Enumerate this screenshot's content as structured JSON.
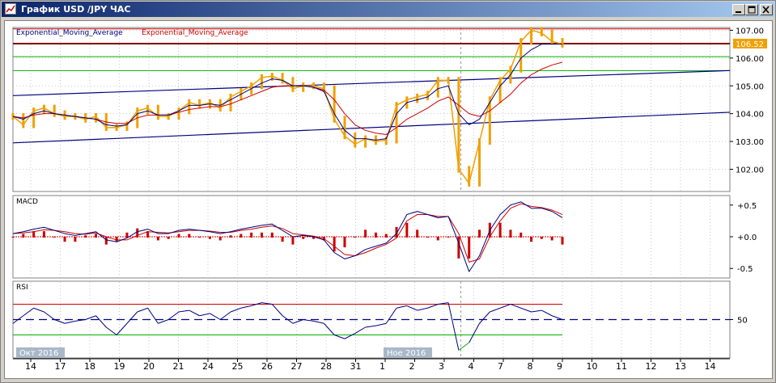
{
  "window": {
    "title": "График USD /JPY ЧАС",
    "buttons": {
      "minimize": "minimize-icon",
      "maximize": "maximize-icon",
      "close": "close-icon"
    }
  },
  "colors": {
    "price": "#f0a000",
    "ema_fast": "#000080",
    "ema_slow": "#cc0000",
    "resistance_line": "#cc0000",
    "support_line": "#00b000",
    "trend_line": "#000080",
    "macd_line": "#000080",
    "signal_line": "#cc0000",
    "histogram": "#cc0000",
    "rsi": "#000080",
    "rsi_overbought": "#e000e0",
    "rsi_oversold": "#00b000",
    "price_label_bg": "#f0a000",
    "date_marker_bg": "#a8b8c8"
  },
  "chart_data": [
    {
      "type": "line",
      "panel": "price",
      "legend": [
        "Exponential_Moving_Average",
        "Exponential_Moving_Average"
      ],
      "last_price_label": "106.52",
      "y_ticks": [
        "107.00",
        "106.00",
        "105.00",
        "104.00",
        "103.00",
        "102.00"
      ],
      "ylim": [
        101.2,
        107.1
      ],
      "horizontal_levels": [
        {
          "value": 107.05,
          "color": "red"
        },
        {
          "value": 106.52,
          "color": "darkred"
        },
        {
          "value": 106.05,
          "color": "green"
        },
        {
          "value": 105.55,
          "color": "green"
        }
      ],
      "trend_lines": [
        {
          "from": [
            0,
            104.65
          ],
          "to": [
            54,
            105.55
          ]
        },
        {
          "from": [
            0,
            102.95
          ],
          "to": [
            54,
            104.05
          ]
        }
      ],
      "series": [
        {
          "name": "price",
          "x": [
            0,
            1,
            2,
            3,
            4,
            5,
            6,
            7,
            8,
            9,
            10,
            11,
            12,
            13,
            14,
            15,
            16,
            17,
            18,
            19,
            20,
            21,
            22,
            23,
            24,
            25,
            26,
            27,
            28,
            29,
            30,
            31,
            32,
            33,
            34,
            35,
            36,
            37,
            38,
            39,
            40,
            41,
            42,
            43,
            44,
            45,
            46,
            47,
            48,
            49,
            50,
            51,
            52,
            53
          ],
          "values": [
            103.9,
            103.6,
            104.1,
            104.2,
            104.0,
            103.9,
            103.9,
            103.8,
            103.9,
            103.5,
            103.5,
            103.6,
            104.1,
            104.2,
            103.9,
            103.9,
            104.1,
            104.4,
            104.3,
            104.4,
            104.2,
            104.6,
            104.8,
            105.0,
            105.3,
            105.35,
            105.2,
            104.9,
            105.0,
            105.0,
            104.9,
            103.8,
            103.2,
            102.9,
            103.1,
            103.0,
            103.05,
            104.3,
            104.5,
            104.6,
            104.7,
            105.2,
            105.2,
            102.0,
            101.5,
            103.0,
            104.5,
            105.2,
            105.6,
            106.6,
            107.0,
            106.9,
            106.6,
            106.5
          ]
        },
        {
          "name": "ema_fast",
          "x": [
            0,
            1,
            2,
            3,
            4,
            5,
            6,
            7,
            8,
            9,
            10,
            11,
            12,
            13,
            14,
            15,
            16,
            17,
            18,
            19,
            20,
            21,
            22,
            23,
            24,
            25,
            26,
            27,
            28,
            29,
            30,
            31,
            32,
            33,
            34,
            35,
            36,
            37,
            38,
            39,
            40,
            41,
            42,
            43,
            44,
            45,
            46,
            47,
            48,
            49,
            50,
            51,
            52,
            53
          ],
          "values": [
            103.9,
            103.8,
            104.0,
            104.1,
            104.0,
            103.95,
            103.9,
            103.85,
            103.8,
            103.6,
            103.55,
            103.6,
            104.0,
            104.1,
            103.95,
            103.95,
            104.1,
            104.3,
            104.3,
            104.35,
            104.3,
            104.5,
            104.7,
            104.9,
            105.1,
            105.25,
            105.2,
            105.0,
            105.0,
            104.95,
            104.8,
            104.0,
            103.4,
            103.1,
            103.1,
            103.05,
            103.1,
            104.0,
            104.4,
            104.5,
            104.6,
            104.9,
            105.0,
            104.0,
            103.6,
            103.8,
            104.4,
            105.0,
            105.4,
            106.0,
            106.3,
            106.5,
            106.5,
            106.5
          ]
        },
        {
          "name": "ema_slow",
          "x": [
            0,
            1,
            2,
            3,
            4,
            5,
            6,
            7,
            8,
            9,
            10,
            11,
            12,
            13,
            14,
            15,
            16,
            17,
            18,
            19,
            20,
            21,
            22,
            23,
            24,
            25,
            26,
            27,
            28,
            29,
            30,
            31,
            32,
            33,
            34,
            35,
            36,
            37,
            38,
            39,
            40,
            41,
            42,
            43,
            44,
            45,
            46,
            47,
            48,
            49,
            50,
            51,
            52,
            53
          ],
          "values": [
            103.9,
            103.85,
            103.95,
            104.0,
            104.0,
            103.95,
            103.9,
            103.85,
            103.8,
            103.7,
            103.65,
            103.65,
            103.85,
            103.95,
            103.95,
            103.95,
            104.05,
            104.15,
            104.2,
            104.25,
            104.25,
            104.35,
            104.5,
            104.65,
            104.8,
            104.95,
            105.0,
            105.0,
            105.0,
            104.95,
            104.85,
            104.5,
            104.0,
            103.6,
            103.4,
            103.3,
            103.25,
            103.5,
            103.8,
            104.0,
            104.2,
            104.45,
            104.6,
            104.3,
            104.0,
            103.9,
            104.1,
            104.4,
            104.7,
            105.1,
            105.4,
            105.6,
            105.75,
            105.85
          ]
        }
      ]
    },
    {
      "type": "line",
      "panel": "macd",
      "title": "MACD",
      "y_ticks": [
        "+0.5",
        "+0.0",
        "-0.5"
      ],
      "ylim": [
        -0.65,
        0.65
      ],
      "series": [
        {
          "name": "macd",
          "x": [
            0,
            1,
            2,
            3,
            4,
            5,
            6,
            7,
            8,
            9,
            10,
            11,
            12,
            13,
            14,
            15,
            16,
            17,
            18,
            19,
            20,
            21,
            22,
            23,
            24,
            25,
            26,
            27,
            28,
            29,
            30,
            31,
            32,
            33,
            34,
            35,
            36,
            37,
            38,
            39,
            40,
            41,
            42,
            43,
            44,
            45,
            46,
            47,
            48,
            49,
            50,
            51,
            52,
            53
          ],
          "values": [
            0.05,
            0.08,
            0.12,
            0.15,
            0.1,
            0.05,
            0.02,
            0.05,
            0.08,
            -0.05,
            -0.08,
            -0.02,
            0.08,
            0.12,
            0.05,
            0.05,
            0.1,
            0.12,
            0.1,
            0.08,
            0.05,
            0.08,
            0.12,
            0.15,
            0.18,
            0.2,
            0.1,
            0.0,
            0.02,
            0.0,
            -0.05,
            -0.25,
            -0.35,
            -0.3,
            -0.2,
            -0.15,
            -0.1,
            0.05,
            0.35,
            0.4,
            0.35,
            0.3,
            0.32,
            -0.1,
            -0.55,
            -0.3,
            0.1,
            0.35,
            0.5,
            0.55,
            0.45,
            0.45,
            0.4,
            0.3
          ]
        },
        {
          "name": "signal",
          "x": [
            0,
            1,
            2,
            3,
            4,
            5,
            6,
            7,
            8,
            9,
            10,
            11,
            12,
            13,
            14,
            15,
            16,
            17,
            18,
            19,
            20,
            21,
            22,
            23,
            24,
            25,
            26,
            27,
            28,
            29,
            30,
            31,
            32,
            33,
            34,
            35,
            36,
            37,
            38,
            39,
            40,
            41,
            42,
            43,
            44,
            45,
            46,
            47,
            48,
            49,
            50,
            51,
            52,
            53
          ],
          "values": [
            0.05,
            0.06,
            0.08,
            0.11,
            0.1,
            0.08,
            0.05,
            0.04,
            0.06,
            0.0,
            -0.05,
            -0.05,
            0.02,
            0.08,
            0.07,
            0.06,
            0.08,
            0.1,
            0.1,
            0.09,
            0.07,
            0.07,
            0.1,
            0.12,
            0.15,
            0.17,
            0.13,
            0.05,
            0.03,
            0.01,
            -0.03,
            -0.15,
            -0.28,
            -0.3,
            -0.25,
            -0.18,
            -0.12,
            -0.02,
            0.25,
            0.35,
            0.35,
            0.32,
            0.32,
            0.05,
            -0.4,
            -0.35,
            0.0,
            0.25,
            0.45,
            0.52,
            0.48,
            0.46,
            0.42,
            0.35
          ]
        }
      ]
    },
    {
      "type": "line",
      "panel": "rsi",
      "title": "RSI",
      "y_ticks": [
        "50"
      ],
      "ylim": [
        0,
        100
      ],
      "levels": [
        70,
        30
      ],
      "series": [
        {
          "name": "rsi",
          "x": [
            0,
            1,
            2,
            3,
            4,
            5,
            6,
            7,
            8,
            9,
            10,
            11,
            12,
            13,
            14,
            15,
            16,
            17,
            18,
            19,
            20,
            21,
            22,
            23,
            24,
            25,
            26,
            27,
            28,
            29,
            30,
            31,
            32,
            33,
            34,
            35,
            36,
            37,
            38,
            39,
            40,
            41,
            42,
            43,
            44,
            45,
            46,
            47,
            48,
            49,
            50,
            51,
            52,
            53
          ],
          "values": [
            45,
            55,
            65,
            60,
            50,
            45,
            48,
            50,
            55,
            40,
            30,
            45,
            60,
            65,
            45,
            50,
            60,
            62,
            55,
            58,
            50,
            60,
            65,
            68,
            72,
            70,
            55,
            45,
            50,
            48,
            45,
            30,
            25,
            32,
            40,
            42,
            45,
            65,
            68,
            62,
            65,
            70,
            72,
            10,
            20,
            45,
            60,
            65,
            70,
            65,
            60,
            62,
            55,
            50
          ]
        }
      ]
    }
  ],
  "x_axis": {
    "labels": [
      "14",
      "17",
      "18",
      "19",
      "20",
      "21",
      "24",
      "25",
      "26",
      "27",
      "28",
      "31",
      "1",
      "2",
      "3",
      "4",
      "7",
      "8",
      "9",
      "10",
      "11",
      "12",
      "13",
      "14"
    ],
    "month_markers": [
      {
        "label": "Окт 2016"
      },
      {
        "label": "Ное 2016"
      }
    ]
  }
}
